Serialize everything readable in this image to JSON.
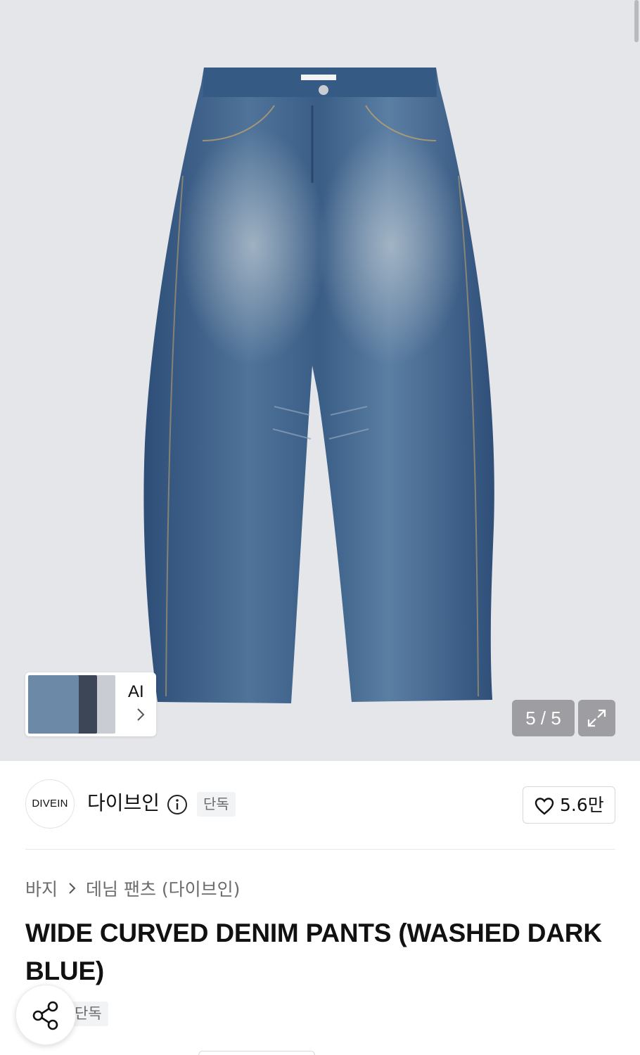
{
  "gallery": {
    "image_alt": "WIDE CURVED DENIM PANTS (WASHED DARK BLUE)",
    "counter": "5 / 5",
    "ai_label": "AI",
    "expand_icon": "expand-icon",
    "chevron_icon": "chevron-right-icon"
  },
  "brand": {
    "logo_text": "DIVEIN",
    "name": "다이브인",
    "info_icon": "info-icon",
    "badge": "단독",
    "like_icon": "heart-icon",
    "like_count": "5.6만"
  },
  "breadcrumb": {
    "items": [
      "바지",
      "데님 팬츠 (다이브인)"
    ]
  },
  "product": {
    "title": "WIDE CURVED DENIM PANTS (WASHED DARK BLUE)",
    "badge": "단독"
  },
  "share": {
    "icon": "share-icon"
  },
  "colors": {
    "hero_bg": "#e5e6e9",
    "denim": "#3b5f8a",
    "text_primary": "#111111",
    "text_secondary": "#6b6b6b",
    "badge_bg": "#f2f3f5"
  }
}
